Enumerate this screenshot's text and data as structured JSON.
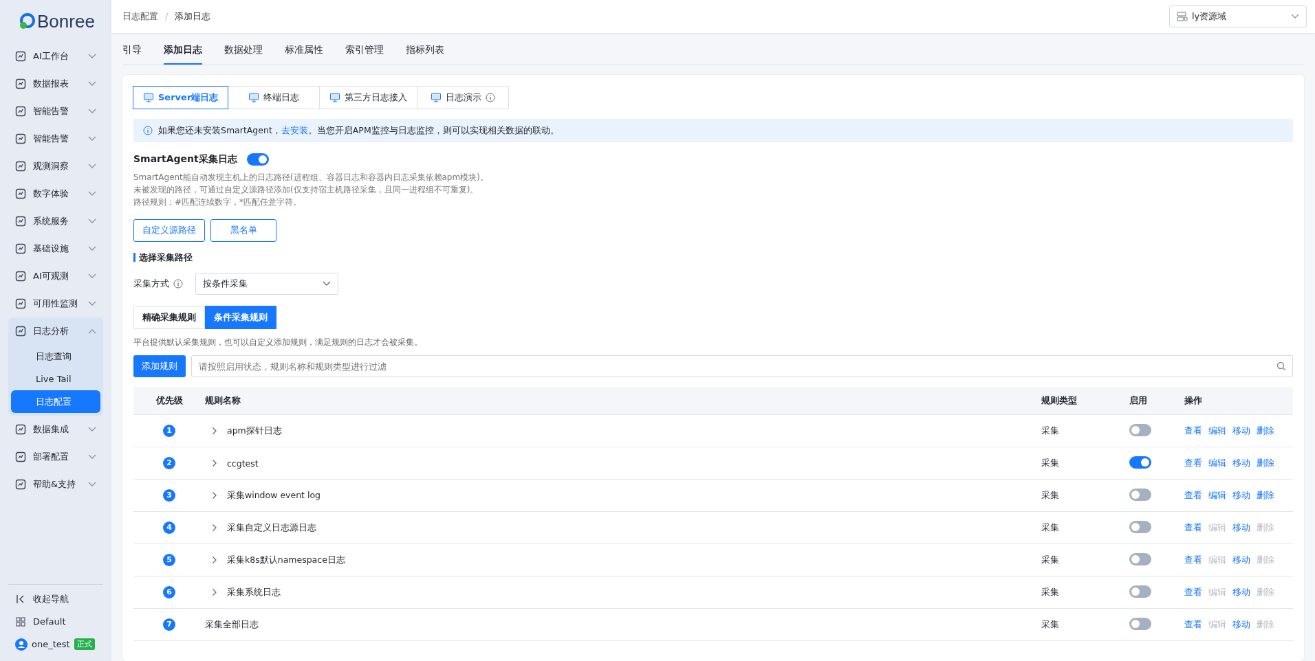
{
  "sidebar": {
    "logo": "Bonree",
    "items": [
      {
        "label": "AI工作台",
        "expanded": false
      },
      {
        "label": "数据报表",
        "expanded": false
      },
      {
        "label": "智能告警",
        "expanded": false
      },
      {
        "label": "智能告警",
        "expanded": false
      },
      {
        "label": "观测洞察",
        "expanded": false
      },
      {
        "label": "数字体验",
        "expanded": false
      },
      {
        "label": "系统服务",
        "expanded": false
      },
      {
        "label": "基础设施",
        "expanded": false
      },
      {
        "label": "AI可观测",
        "expanded": false
      },
      {
        "label": "可用性监测",
        "expanded": false
      },
      {
        "label": "日志分析",
        "expanded": true,
        "children": [
          {
            "label": "日志查询",
            "selected": false
          },
          {
            "label": "Live Tail",
            "selected": false
          },
          {
            "label": "日志配置",
            "selected": true
          }
        ]
      },
      {
        "label": "数据集成",
        "expanded": false
      },
      {
        "label": "部署配置",
        "expanded": false
      },
      {
        "label": "帮助&支持",
        "expanded": false
      }
    ],
    "collapse": "收起导航",
    "workspace": "Default",
    "user": "one_test",
    "user_badge": "正式"
  },
  "breadcrumb": [
    "日志配置",
    "添加日志"
  ],
  "breadcrumb_separator": "/",
  "domain_select": "ly资源域",
  "tabs": [
    {
      "label": "引导",
      "selected": false
    },
    {
      "label": "添加日志",
      "selected": true
    },
    {
      "label": "数据处理",
      "selected": false
    },
    {
      "label": "标准属性",
      "selected": false
    },
    {
      "label": "索引管理",
      "selected": false
    },
    {
      "label": "指标列表",
      "selected": false
    }
  ],
  "source_tabs": [
    {
      "label": "Server端日志",
      "selected": true,
      "info": false
    },
    {
      "label": "终端日志",
      "selected": false,
      "info": false
    },
    {
      "label": "第三方日志接入",
      "selected": false,
      "info": false
    },
    {
      "label": "日志演示",
      "selected": false,
      "info": true
    }
  ],
  "notice": {
    "before": "如果您还未安装SmartAgent，",
    "link": "去安装",
    "after": "。当您开启APM监控与日志监控，则可以实现相关数据的联动。"
  },
  "smartagent": {
    "title": "SmartAgent采集日志",
    "on": true,
    "lines": [
      "SmartAgent能自动发现主机上的日志路径(进程组、容器日志和容器内日志采集依赖apm模块)。",
      "未被发现的路径，可通过自定义源路径添加(仅支持宿主机路径采集，且同一进程组不可重复)。",
      "路径规则：#匹配连续数字，*匹配任意字符。"
    ],
    "buttons": [
      "自定义源路径",
      "黑名单"
    ]
  },
  "section_title": "选择采集路径",
  "method": {
    "label": "采集方式",
    "value": "按条件采集"
  },
  "rule_tabs": [
    {
      "label": "精确采集规则",
      "selected": false
    },
    {
      "label": "条件采集规则",
      "selected": true
    }
  ],
  "rule_hint": "平台提供默认采集规则，也可以自定义添加规则，满足规则的日志才会被采集。",
  "add_button": "添加规则",
  "filter": {
    "placeholder": "请按照启用状态，规则名称和规则类型进行过滤"
  },
  "table": {
    "columns": [
      "优先级",
      "规则名称",
      "规则类型",
      "启用",
      "操作"
    ],
    "rows": [
      {
        "priority": "1",
        "name": "apm探针日志",
        "expandable": true,
        "type": "采集",
        "on": false,
        "actions": [
          {
            "label": "查看",
            "disabled": false
          },
          {
            "label": "编辑",
            "disabled": false
          },
          {
            "label": "移动",
            "disabled": false
          },
          {
            "label": "删除",
            "disabled": false
          }
        ]
      },
      {
        "priority": "2",
        "name": "ccgtest",
        "expandable": true,
        "type": "采集",
        "on": true,
        "actions": [
          {
            "label": "查看",
            "disabled": false
          },
          {
            "label": "编辑",
            "disabled": false
          },
          {
            "label": "移动",
            "disabled": false
          },
          {
            "label": "删除",
            "disabled": false
          }
        ]
      },
      {
        "priority": "3",
        "name": "采集window event log",
        "expandable": true,
        "type": "采集",
        "on": false,
        "actions": [
          {
            "label": "查看",
            "disabled": false
          },
          {
            "label": "编辑",
            "disabled": false
          },
          {
            "label": "移动",
            "disabled": false
          },
          {
            "label": "删除",
            "disabled": false
          }
        ]
      },
      {
        "priority": "4",
        "name": "采集自定义日志源日志",
        "expandable": true,
        "type": "采集",
        "on": false,
        "actions": [
          {
            "label": "查看",
            "disabled": false
          },
          {
            "label": "编辑",
            "disabled": true
          },
          {
            "label": "移动",
            "disabled": false
          },
          {
            "label": "删除",
            "disabled": true
          }
        ]
      },
      {
        "priority": "5",
        "name": "采集k8s默认namespace日志",
        "expandable": true,
        "type": "采集",
        "on": false,
        "actions": [
          {
            "label": "查看",
            "disabled": false
          },
          {
            "label": "编辑",
            "disabled": true
          },
          {
            "label": "移动",
            "disabled": false
          },
          {
            "label": "删除",
            "disabled": true
          }
        ]
      },
      {
        "priority": "6",
        "name": "采集系统日志",
        "expandable": true,
        "type": "采集",
        "on": false,
        "actions": [
          {
            "label": "查看",
            "disabled": false
          },
          {
            "label": "编辑",
            "disabled": true
          },
          {
            "label": "移动",
            "disabled": false
          },
          {
            "label": "删除",
            "disabled": true
          }
        ]
      },
      {
        "priority": "7",
        "name": "采集全部日志",
        "expandable": false,
        "type": "采集",
        "on": false,
        "actions": [
          {
            "label": "查看",
            "disabled": false
          },
          {
            "label": "编辑",
            "disabled": true
          },
          {
            "label": "移动",
            "disabled": false
          },
          {
            "label": "删除",
            "disabled": true
          }
        ]
      }
    ]
  }
}
